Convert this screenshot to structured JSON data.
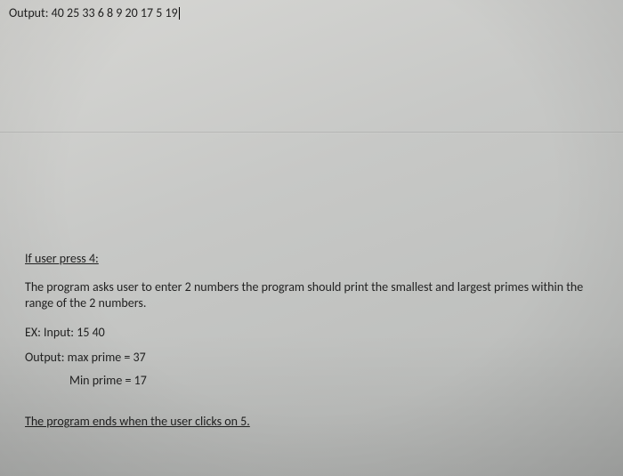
{
  "top": {
    "label": "Output:",
    "value": "40 25 33 6 8 9 20 17 5 19"
  },
  "section": {
    "heading": "If user press 4:",
    "description": "The program asks user to enter 2 numbers the program should print the smallest and largest primes within the range of the 2 numbers.",
    "example_label": "EX: Input:",
    "example_input": "15    40",
    "output_label": "Output:",
    "max_prime": "max prime = 37",
    "min_prime": "Min prime = 17",
    "end_note": "The program ends when the user clicks on 5."
  }
}
